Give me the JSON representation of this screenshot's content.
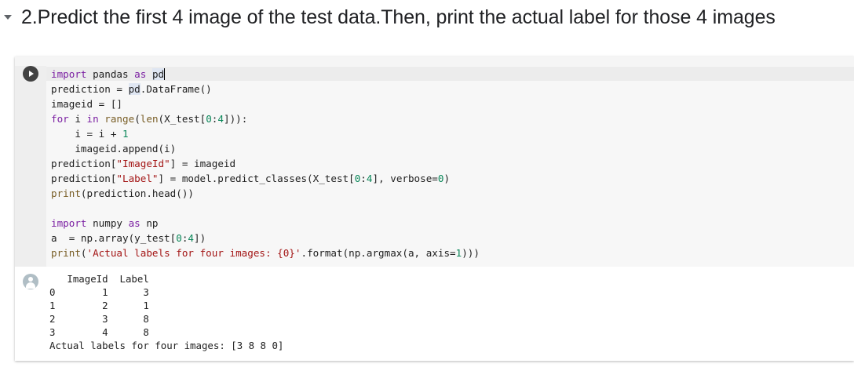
{
  "section": {
    "heading": "2.Predict the first 4 image of the test data.Then, print the actual label for those 4 images"
  },
  "cell": {
    "code_lines": [
      [
        {
          "t": "import",
          "c": "k"
        },
        {
          "t": " pandas "
        },
        {
          "t": "as",
          "c": "k"
        },
        {
          "t": " "
        },
        {
          "t": "pd",
          "c": "pd-hl"
        },
        {
          "caret": true
        }
      ],
      [
        {
          "t": "prediction = "
        },
        {
          "t": "pd",
          "c": "pd-hl"
        },
        {
          "t": ".DataFrame()"
        }
      ],
      [
        {
          "t": "imageid = []"
        }
      ],
      [
        {
          "t": "for",
          "c": "k"
        },
        {
          "t": " i "
        },
        {
          "t": "in",
          "c": "k"
        },
        {
          "t": " "
        },
        {
          "t": "range",
          "c": "b"
        },
        {
          "t": "("
        },
        {
          "t": "len",
          "c": "b"
        },
        {
          "t": "(X_test["
        },
        {
          "t": "0",
          "c": "n"
        },
        {
          "t": ":"
        },
        {
          "t": "4",
          "c": "n"
        },
        {
          "t": "])):"
        }
      ],
      [
        {
          "t": "    i = i + "
        },
        {
          "t": "1",
          "c": "n"
        }
      ],
      [
        {
          "t": "    imageid.append(i)"
        }
      ],
      [
        {
          "t": "prediction["
        },
        {
          "t": "\"ImageId\"",
          "c": "s"
        },
        {
          "t": "] = imageid"
        }
      ],
      [
        {
          "t": "prediction["
        },
        {
          "t": "\"Label\"",
          "c": "s"
        },
        {
          "t": "] = model.predict_classes(X_test["
        },
        {
          "t": "0",
          "c": "n"
        },
        {
          "t": ":"
        },
        {
          "t": "4",
          "c": "n"
        },
        {
          "t": "], verbose="
        },
        {
          "t": "0",
          "c": "n"
        },
        {
          "t": ")"
        }
      ],
      [
        {
          "t": "print",
          "c": "b"
        },
        {
          "t": "(prediction.head())"
        }
      ],
      [],
      [
        {
          "t": "import",
          "c": "k"
        },
        {
          "t": " numpy "
        },
        {
          "t": "as",
          "c": "k"
        },
        {
          "t": " np"
        }
      ],
      [
        {
          "t": "a  = np.array(y_test["
        },
        {
          "t": "0",
          "c": "n"
        },
        {
          "t": ":"
        },
        {
          "t": "4",
          "c": "n"
        },
        {
          "t": "])"
        }
      ],
      [
        {
          "t": "print",
          "c": "b"
        },
        {
          "t": "("
        },
        {
          "t": "'Actual labels for four images: {0}'",
          "c": "s"
        },
        {
          "t": ".format(np.argmax(a, axis="
        },
        {
          "t": "1",
          "c": "n"
        },
        {
          "t": ")))"
        }
      ]
    ]
  },
  "output": {
    "lines": [
      "   ImageId  Label",
      "0        1      3",
      "1        2      1",
      "2        3      8",
      "3        4      8",
      "Actual labels for four images: [3 8 8 0]"
    ]
  },
  "icons": {
    "collapse": "chevron-down-icon",
    "run": "play-icon",
    "output": "user-avatar-icon"
  },
  "colors": {
    "keyword": "#7b1fa2",
    "string": "#a31515",
    "number": "#098658",
    "builtin": "#795e26"
  }
}
